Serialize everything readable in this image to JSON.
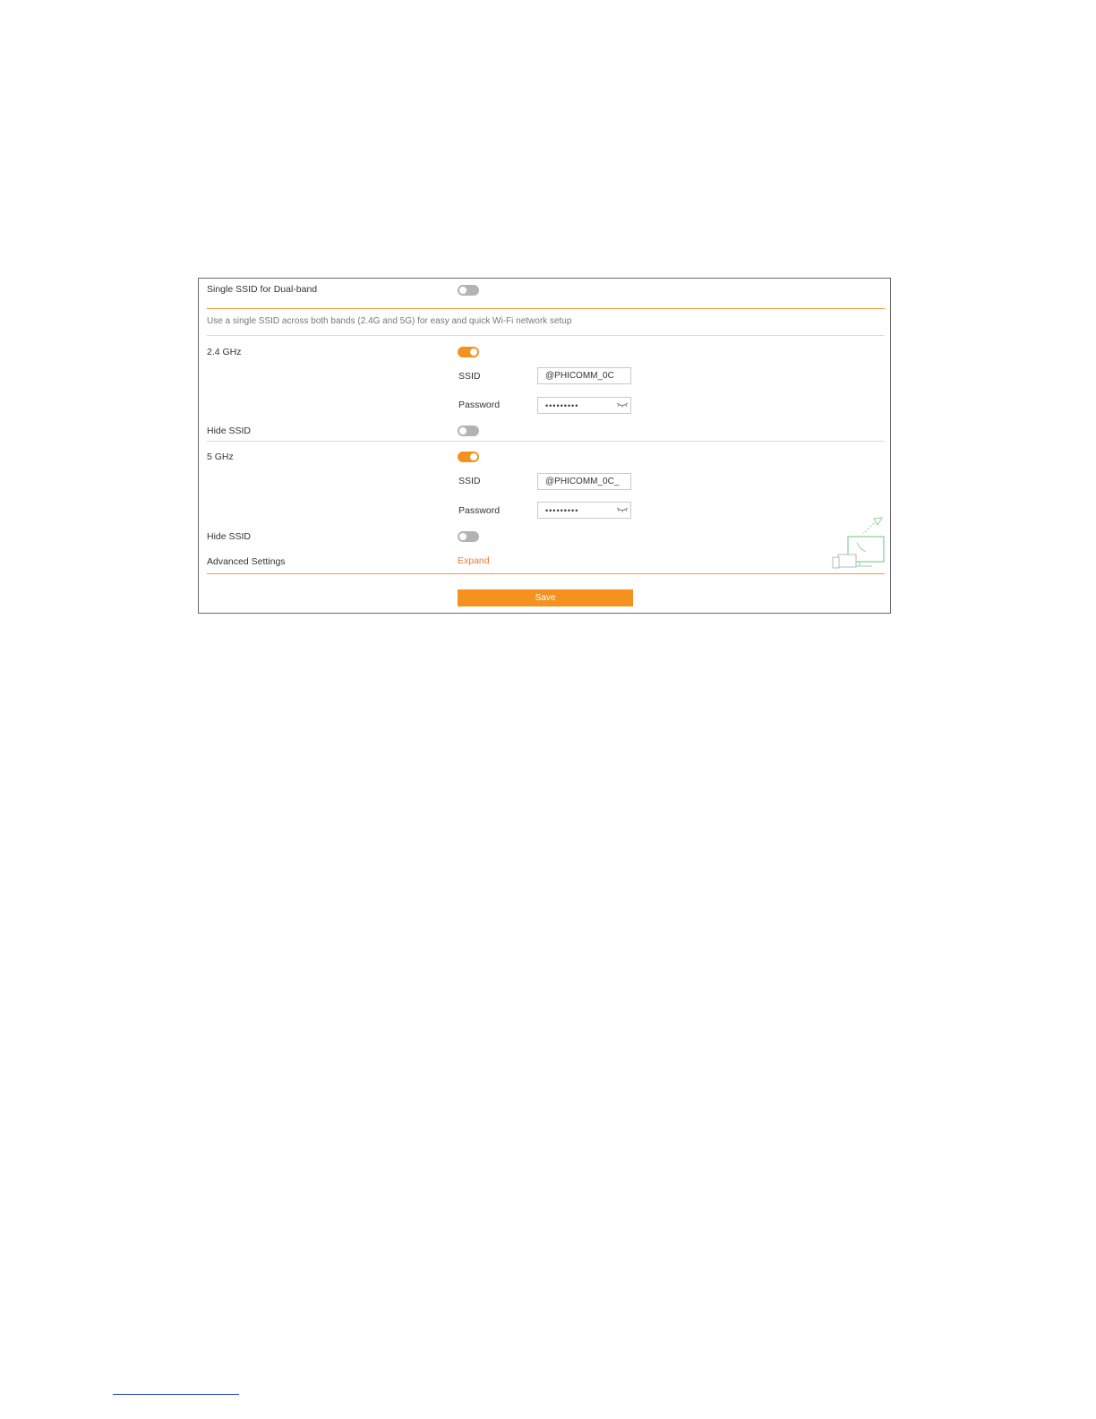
{
  "single_ssid": {
    "label": "Single SSID for Dual-band",
    "enabled": false,
    "description": "Use a single SSID across both bands (2.4G and 5G) for easy and quick Wi-Fi network setup"
  },
  "band_24": {
    "label": "2.4 GHz",
    "enabled": true,
    "ssid_label": "SSID",
    "ssid_value": "@PHICOMM_0C",
    "password_label": "Password",
    "password_value": "•••••••••",
    "hide_ssid_label": "Hide SSID",
    "hide_ssid_enabled": false
  },
  "band_5": {
    "label": "5 GHz",
    "enabled": true,
    "ssid_label": "SSID",
    "ssid_value": "@PHICOMM_0C_",
    "password_label": "Password",
    "password_value": "•••••••••",
    "hide_ssid_label": "Hide SSID",
    "hide_ssid_enabled": false
  },
  "advanced": {
    "label": "Advanced Settings",
    "expand_label": "Expand"
  },
  "save_label": "Save",
  "colors": {
    "accent": "#f5921e",
    "toggle_off": "#b3b3b3",
    "divider": "#f39a3a",
    "illustration": "#8fd19e"
  },
  "icons": [
    "eye-closed-icon",
    "devices-illustration-icon"
  ]
}
